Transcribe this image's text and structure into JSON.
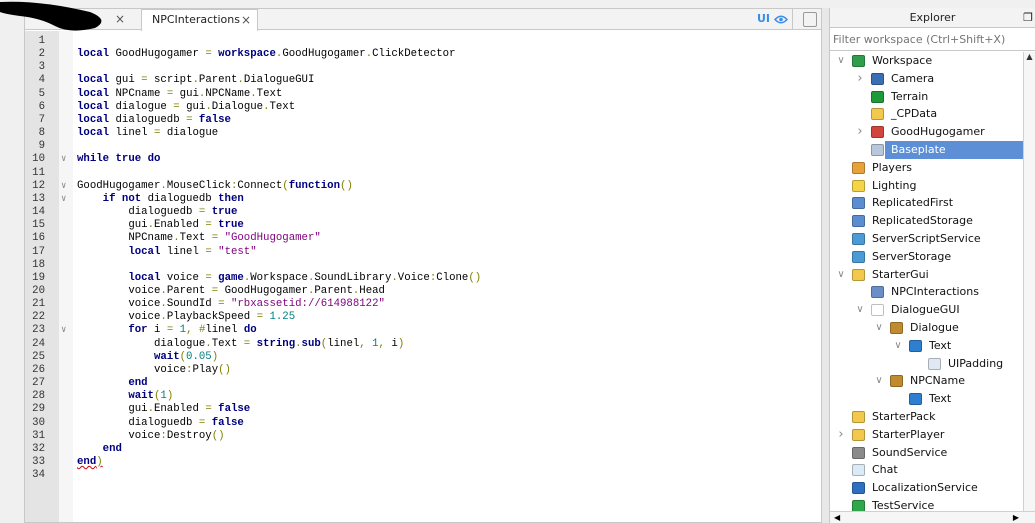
{
  "tabs": [
    {
      "label": "",
      "close": "×"
    },
    {
      "label": "NPCInteractions",
      "close": "×"
    }
  ],
  "toolbar": {
    "ui_label": "UI",
    "ui_icon": "eye-icon",
    "device_icon": "device-icon"
  },
  "code_lines": [
    "",
    "local GoodHugogamer = workspace.GoodHugogamer.ClickDetector",
    "",
    "local gui = script.Parent.DialogueGUI",
    "local NPCname = gui.NPCName.Text",
    "local dialogue = gui.Dialogue.Text",
    "local dialoguedb = false",
    "local linel = dialogue",
    "",
    "while true do",
    "",
    "GoodHugogamer.MouseClick:Connect(function()",
    "    if not dialoguedb then",
    "        dialoguedb = true",
    "        gui.Enabled = true",
    "        NPCname.Text = \"GoodHugogamer\"",
    "        local linel = \"test\"",
    "",
    "        local voice = game.Workspace.SoundLibrary.Voice:Clone()",
    "        voice.Parent = GoodHugogamer.Parent.Head",
    "        voice.SoundId = \"rbxassetid://614988122\"",
    "        voice.PlaybackSpeed = 1.25",
    "        for i = 1, #linel do",
    "            dialogue.Text = string.sub(linel, 1, i)",
    "            wait(0.05)",
    "            voice:Play()",
    "        end",
    "        wait(1)",
    "        gui.Enabled = false",
    "        dialoguedb = false",
    "        voice:Destroy()",
    "    end",
    "end)",
    ""
  ],
  "fold_lines": [
    10,
    12,
    13,
    23
  ],
  "error_lines": [
    33
  ],
  "explorer": {
    "title": "Explorer",
    "filter_placeholder": "Filter workspace (Ctrl+Shift+X)",
    "items": [
      {
        "label": "Workspace",
        "depth": 0,
        "arrow": "open",
        "icon": "workspace-icon",
        "color": "#2e9e4a"
      },
      {
        "label": "Camera",
        "depth": 1,
        "arrow": "closed",
        "icon": "camera-icon",
        "color": "#3b6fb3"
      },
      {
        "label": "Terrain",
        "depth": 1,
        "arrow": "",
        "icon": "terrain-icon",
        "color": "#1f9a3a"
      },
      {
        "label": "_CPData",
        "depth": 1,
        "arrow": "",
        "icon": "folder-icon",
        "color": "#f2c94c"
      },
      {
        "label": "GoodHugogamer",
        "depth": 1,
        "arrow": "closed",
        "icon": "model-icon",
        "color": "#d2453d"
      },
      {
        "label": "Baseplate",
        "depth": 1,
        "arrow": "",
        "icon": "part-icon",
        "color": "#b9c7dc",
        "selected": true
      },
      {
        "label": "Players",
        "depth": 0,
        "arrow": "",
        "icon": "players-icon",
        "color": "#e8a23a"
      },
      {
        "label": "Lighting",
        "depth": 0,
        "arrow": "",
        "icon": "lighting-icon",
        "color": "#f5d547"
      },
      {
        "label": "ReplicatedFirst",
        "depth": 0,
        "arrow": "",
        "icon": "replicated-first-icon",
        "color": "#5b8ed0"
      },
      {
        "label": "ReplicatedStorage",
        "depth": 0,
        "arrow": "",
        "icon": "replicated-storage-icon",
        "color": "#5b8ed0"
      },
      {
        "label": "ServerScriptService",
        "depth": 0,
        "arrow": "",
        "icon": "server-script-service-icon",
        "color": "#4b9bd6"
      },
      {
        "label": "ServerStorage",
        "depth": 0,
        "arrow": "",
        "icon": "server-storage-icon",
        "color": "#4b9bd6"
      },
      {
        "label": "StarterGui",
        "depth": 0,
        "arrow": "open",
        "icon": "starter-gui-icon",
        "color": "#f2c94c"
      },
      {
        "label": "NPCInteractions",
        "depth": 1,
        "arrow": "",
        "icon": "local-script-icon",
        "color": "#6a8fc8"
      },
      {
        "label": "DialogueGUI",
        "depth": 1,
        "arrow": "open",
        "icon": "screen-gui-icon",
        "color": "#ffffff"
      },
      {
        "label": "Dialogue",
        "depth": 2,
        "arrow": "open",
        "icon": "frame-icon",
        "color": "#c08a2e"
      },
      {
        "label": "Text",
        "depth": 3,
        "arrow": "open",
        "icon": "text-label-icon",
        "color": "#2f7fd0"
      },
      {
        "label": "UIPadding",
        "depth": 4,
        "arrow": "",
        "icon": "ui-padding-icon",
        "color": "#dfe8f3"
      },
      {
        "label": "NPCName",
        "depth": 2,
        "arrow": "open",
        "icon": "frame-icon",
        "color": "#c08a2e"
      },
      {
        "label": "Text",
        "depth": 3,
        "arrow": "",
        "icon": "text-label-icon",
        "color": "#2f7fd0"
      },
      {
        "label": "StarterPack",
        "depth": 0,
        "arrow": "",
        "icon": "starter-pack-icon",
        "color": "#f2c94c"
      },
      {
        "label": "StarterPlayer",
        "depth": 0,
        "arrow": "closed",
        "icon": "starter-player-icon",
        "color": "#f2c94c"
      },
      {
        "label": "SoundService",
        "depth": 0,
        "arrow": "",
        "icon": "sound-service-icon",
        "color": "#8a8a8a"
      },
      {
        "label": "Chat",
        "depth": 0,
        "arrow": "",
        "icon": "chat-icon",
        "color": "#dceaf7"
      },
      {
        "label": "LocalizationService",
        "depth": 0,
        "arrow": "",
        "icon": "localization-service-icon",
        "color": "#2f6fc0"
      },
      {
        "label": "TestService",
        "depth": 0,
        "arrow": "",
        "icon": "test-service-icon",
        "color": "#2ea84a"
      }
    ]
  }
}
